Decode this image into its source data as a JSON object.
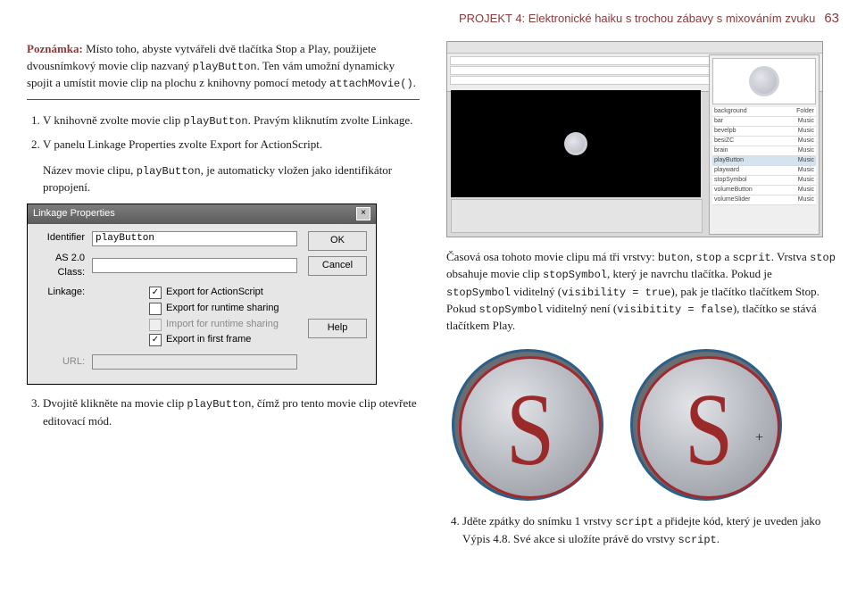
{
  "header": {
    "title": "PROJEKT 4: Elektronické haiku s trochou zábavy s mixováním zvuku",
    "page": "63"
  },
  "note": {
    "label": "Poznámka:",
    "text1": " Místo toho, abyste vytvářeli dvě tlačítka Stop a Play, použijete dvousnímkový movie clip nazvaný ",
    "code1": "playButton",
    "text2": ". Ten vám umožní dynamicky spojit a umístit movie clip na plochu z knihovny pomocí metody ",
    "code2": "attachMovie()",
    "text3": "."
  },
  "steps_left": {
    "s1a": "V knihovně zvolte movie clip ",
    "s1code": "playButton",
    "s1b": ". Pravým kliknutím zvolte Linkage.",
    "s2": "V panelu Linkage Properties zvolte Export for ActionScript.",
    "indent_a": "Název movie clipu, ",
    "indent_code": "playButton",
    "indent_b": ", je automaticky vložen jako identifikátor propojení.",
    "s3a": "Dvojitě klikněte na movie clip ",
    "s3code": "playButton",
    "s3b": ", čímž pro tento movie clip otevřete editovací mód."
  },
  "dlg": {
    "title": "Linkage Properties",
    "identifier_lbl": "Identifier",
    "identifier_val": "playButton",
    "as2_lbl": "AS 2.0 Class:",
    "linkage_lbl": "Linkage:",
    "url_lbl": "URL:",
    "chk1": "Export for ActionScript",
    "chk2": "Export for runtime sharing",
    "chk3": "Import for runtime sharing",
    "chk4": "Export in first frame",
    "ok": "OK",
    "cancel": "Cancel",
    "help": "Help"
  },
  "library": {
    "items": [
      {
        "n": "background",
        "k": "Folder"
      },
      {
        "n": "bar",
        "k": "Music"
      },
      {
        "n": "bevelpb",
        "k": "Music"
      },
      {
        "n": "besiZC",
        "k": "Music"
      },
      {
        "n": "brain",
        "k": "Music"
      },
      {
        "n": "playButton",
        "k": "Music"
      },
      {
        "n": "playward",
        "k": "Music"
      },
      {
        "n": "stopSymbol",
        "k": "Music"
      },
      {
        "n": "volumeButton",
        "k": "Music"
      },
      {
        "n": "volumeSlider",
        "k": "Music"
      }
    ]
  },
  "right": {
    "p1a": "Časová osa tohoto movie clipu má tři vrstvy: ",
    "c1": "buton",
    "p1b": ", ",
    "c2": "stop",
    "p1c": " a ",
    "c3": "scprit",
    "p1d": ". Vrstva ",
    "c4": "stop",
    "p1e": " obsahuje movie clip ",
    "c5": "stopSymbol",
    "p1f": ", který je navrchu tlačítka. Pokud je ",
    "c6": "stopSymbol",
    "p1g": " viditelný (",
    "c7": "visibility = true",
    "p1h": "), pak je tlačítko tlačítkem Stop. Pokud ",
    "c8": "stopSymbol",
    "p1i": " viditelný není (",
    "c9": "visibitity = false",
    "p1j": "), tlačítko se stává tlačítkem Play.",
    "s4a": "Jděte zpátky do snímku 1 vrstvy ",
    "s4c1": "script",
    "s4b": " a přidejte kód, který je uveden jako Výpis 4.8. Své akce si uložíte právě do vrstvy ",
    "s4c2": "script",
    "s4c": "."
  }
}
